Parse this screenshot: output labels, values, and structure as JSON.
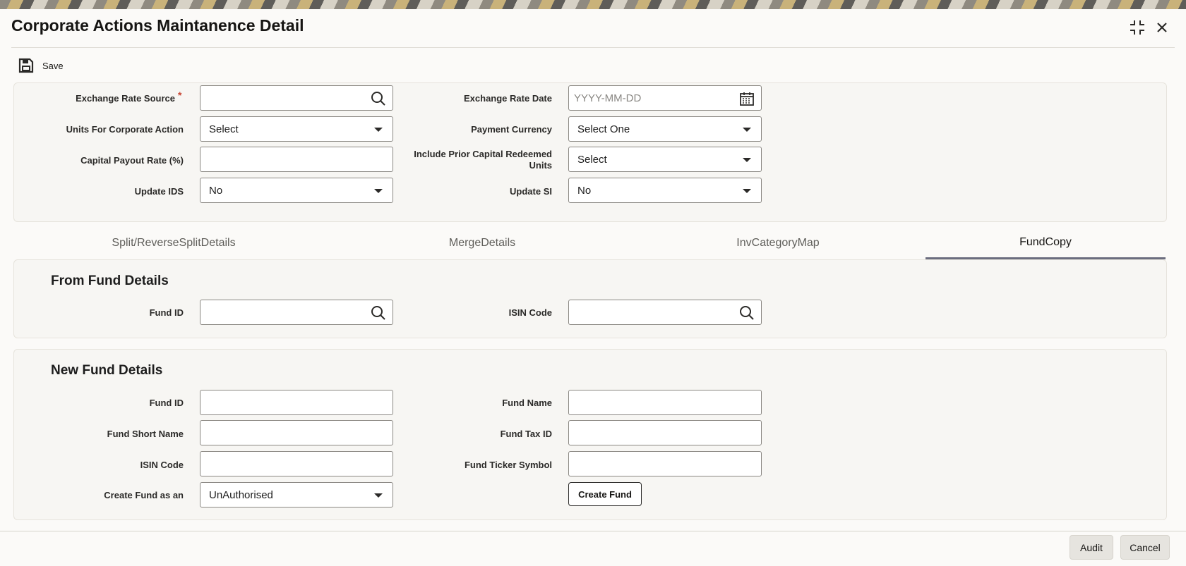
{
  "header": {
    "title": "Corporate Actions Maintanence Detail",
    "icons": {
      "maximize": "collapse-icon",
      "close": "close-icon"
    }
  },
  "toolbar": {
    "save_label": "Save",
    "save_icon": "floppy-disk-icon"
  },
  "general": {
    "exchange_rate_source": {
      "label": "Exchange Rate Source",
      "required_mark": "*",
      "value": ""
    },
    "exchange_rate_date": {
      "label": "Exchange Rate Date",
      "placeholder": "YYYY-MM-DD"
    },
    "units_for_corporate_action": {
      "label": "Units For Corporate Action",
      "value": "Select"
    },
    "payment_currency": {
      "label": "Payment Currency",
      "value": "Select One"
    },
    "capital_payout_rate": {
      "label": "Capital Payout Rate (%)",
      "value": ""
    },
    "include_prior_capital": {
      "label_line1": "Include Prior Capital Redeemed",
      "label_line2": "Units",
      "value": "Select"
    },
    "update_ids": {
      "label": "Update IDS",
      "value": "No"
    },
    "update_si": {
      "label": "Update SI",
      "value": "No"
    }
  },
  "tabs": [
    {
      "label": "Split/ReverseSplitDetails",
      "active": false
    },
    {
      "label": "MergeDetails",
      "active": false
    },
    {
      "label": "InvCategoryMap",
      "active": false
    },
    {
      "label": "FundCopy",
      "active": true
    }
  ],
  "from_fund": {
    "title": "From Fund Details",
    "fund_id": {
      "label": "Fund ID",
      "value": ""
    },
    "isin_code": {
      "label": "ISIN Code",
      "value": ""
    }
  },
  "new_fund": {
    "title": "New Fund Details",
    "fund_id": {
      "label": "Fund ID",
      "value": ""
    },
    "fund_name": {
      "label": "Fund Name",
      "value": ""
    },
    "fund_short_name": {
      "label": "Fund Short Name",
      "value": ""
    },
    "fund_tax_id": {
      "label": "Fund Tax ID",
      "value": ""
    },
    "isin_code": {
      "label": "ISIN Code",
      "value": ""
    },
    "fund_ticker_symbol": {
      "label": "Fund Ticker Symbol",
      "value": ""
    },
    "create_fund_as": {
      "label": "Create Fund as an",
      "value": "UnAuthorised"
    },
    "create_fund_button": "Create Fund"
  },
  "footer": {
    "audit": "Audit",
    "cancel": "Cancel"
  },
  "colors": {
    "accent_tab": "#6b6d7f",
    "required": "#c74634",
    "panel_bg": "#f7f6f3"
  }
}
